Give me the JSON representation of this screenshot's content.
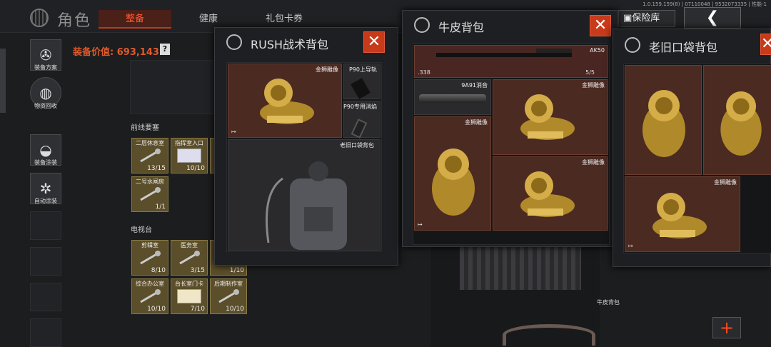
{
  "header": {
    "title": "角色",
    "tabs": [
      "整备",
      "健康",
      "礼包卡券"
    ],
    "active_tab": "整备",
    "version": "1.0.159.159(8) | 07110048 | 9532073335 | 性能-1",
    "vault_label": "保险库",
    "back_icon": "chevron-left-icon"
  },
  "sidebar": {
    "items": [
      {
        "label": "装备方案",
        "icon": "gun-icon"
      },
      {
        "label": "物资回收",
        "icon": "bag-icon"
      },
      {
        "label": "装备涂装",
        "icon": "helmet-icon"
      },
      {
        "label": "自动涂装",
        "icon": "spray-icon"
      }
    ]
  },
  "equipment_value": "装备价值: 693,143",
  "help_label": "?",
  "sections": [
    {
      "title": "前线要塞",
      "keys": [
        {
          "name": "二层休息室",
          "count": "13/15"
        },
        {
          "name": "指挥室入口",
          "count": "10/10"
        },
        {
          "name": "二号水闸房",
          "count": "1/1"
        }
      ]
    },
    {
      "title": "电视台",
      "keys": [
        {
          "name": "剪辑室",
          "count": "8/10"
        },
        {
          "name": "医务室",
          "count": "3/15"
        },
        {
          "name": "",
          "count": "1/10"
        },
        {
          "name": "综合办公室",
          "count": "10/10"
        },
        {
          "name": "台长室门卡",
          "count": "7/10"
        },
        {
          "name": "后期制作室",
          "count": "10/10"
        }
      ]
    }
  ],
  "panels": {
    "rush": {
      "title": "RUSH战术背包",
      "items": {
        "lion": "金狮雕像",
        "rail": "P90上导轨",
        "muzzle": "P90专用消焰",
        "backpack": "老旧口袋背包"
      }
    },
    "leather": {
      "title": "牛皮背包",
      "gun": {
        "name": "AK50",
        "caliber": ".338",
        "ammo": "5/5"
      },
      "suppressor": "9A91消音",
      "lions": [
        "金狮雕像",
        "金狮雕像",
        "金狮雕像"
      ]
    },
    "old": {
      "title": "老旧口袋背包",
      "lions": [
        "金狮雕像",
        "金狮雕像",
        "金狮雕像"
      ]
    }
  },
  "bottom_label": "牛皮背包",
  "add_button": "+",
  "colors": {
    "accent": "#e05a2a",
    "close": "#c73a1a",
    "gold": "#c9a13a"
  }
}
